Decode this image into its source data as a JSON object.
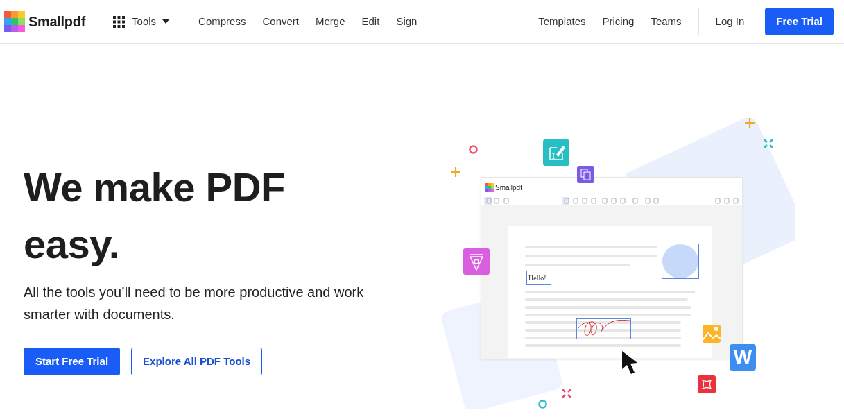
{
  "navbar": {
    "brand": "Smallpdf",
    "tools_menu": "Tools",
    "links": [
      "Compress",
      "Convert",
      "Merge",
      "Edit",
      "Sign"
    ],
    "right_links": [
      "Templates",
      "Pricing",
      "Teams"
    ],
    "login": "Log In",
    "cta": "Free Trial"
  },
  "hero": {
    "heading": "We make PDF easy.",
    "subheading": "All the tools you’ll need to be more productive and work smarter with documents.",
    "buttons": [
      {
        "label": "Start Free Trial",
        "kind": "primary"
      },
      {
        "label": "Explore All PDF Tools",
        "kind": "outline"
      }
    ]
  },
  "illustration": {
    "app_title": "Smallpdf",
    "text_annotation": "Hello!",
    "word_tile": "W"
  }
}
